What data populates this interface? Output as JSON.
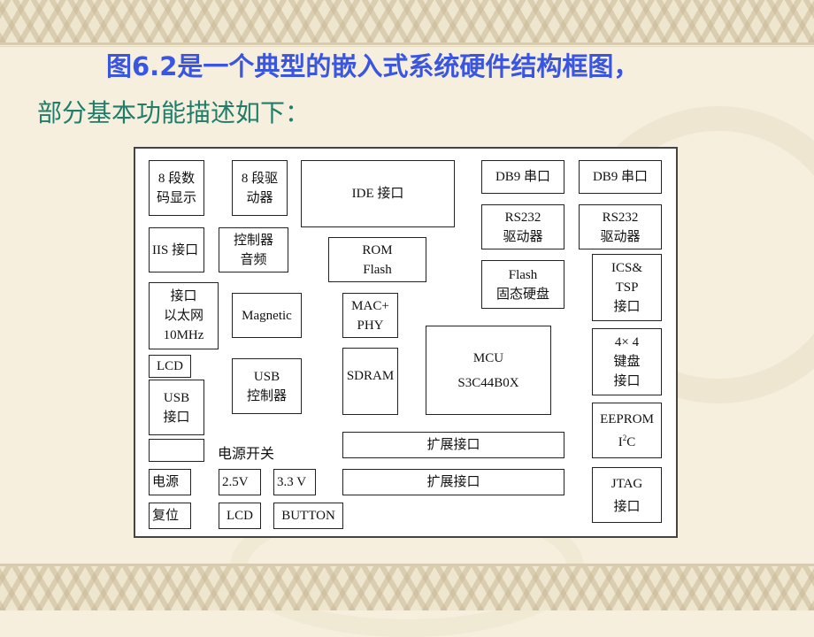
{
  "slide": {
    "title_line1": "图6.2是一个典型的嵌入式系统硬件结构框图，",
    "title_line2": "部分基本功能描述如下：",
    "colors": {
      "title_blue": "#3a55e0",
      "title_green": "#1f7d6a",
      "background": "#f6efdd",
      "box_border": "#222222"
    }
  },
  "diagram": {
    "blocks": {
      "seg_display": [
        "8  段数",
        "码显示"
      ],
      "seg_driver": [
        "8 段驱",
        "动器"
      ],
      "ide": [
        "IDE 接口"
      ],
      "db9_1": [
        "DB9 串口"
      ],
      "db9_2": [
        "DB9 串口"
      ],
      "iis": [
        "IIS 接口"
      ],
      "audio_ctrl": [
        "控制器",
        "音频"
      ],
      "rom_flash": [
        "ROM",
        "Flash"
      ],
      "rs232_1": [
        "RS232",
        "驱动器"
      ],
      "rs232_2": [
        "RS232",
        "驱动器"
      ],
      "ethernet": [
        "接口",
        "以太网",
        "10MHz"
      ],
      "magnetic": [
        "Magnetic"
      ],
      "mac_phy": [
        "MAC+",
        "PHY"
      ],
      "flash_ssd": [
        "Flash",
        "固态硬盘"
      ],
      "ics_tsp": [
        "ICS&",
        "TSP",
        "接口"
      ],
      "lcd1": [
        "LCD"
      ],
      "usb_port": [
        "USB",
        "接口"
      ],
      "usb_ctrl": [
        "USB",
        "控制器"
      ],
      "sdram": [
        "SDRAM"
      ],
      "mcu": [
        "MCU",
        "S3C44B0X"
      ],
      "keypad": [
        "4× 4",
        "键盘",
        "接口"
      ],
      "eeprom": [
        "EEPROM",
        "I",
        "2",
        "C"
      ],
      "expansion1": [
        "扩展接口"
      ],
      "expansion2": [
        "扩展接口"
      ],
      "power_switch_label": "电源开关",
      "power": [
        "电源"
      ],
      "v25": [
        "2.5V"
      ],
      "v33": [
        "3.3 V"
      ],
      "jtag": [
        "JTAG",
        "接口"
      ],
      "reset": [
        "复位"
      ],
      "lcd2": [
        "LCD"
      ],
      "button": [
        "BUTTON"
      ]
    }
  }
}
